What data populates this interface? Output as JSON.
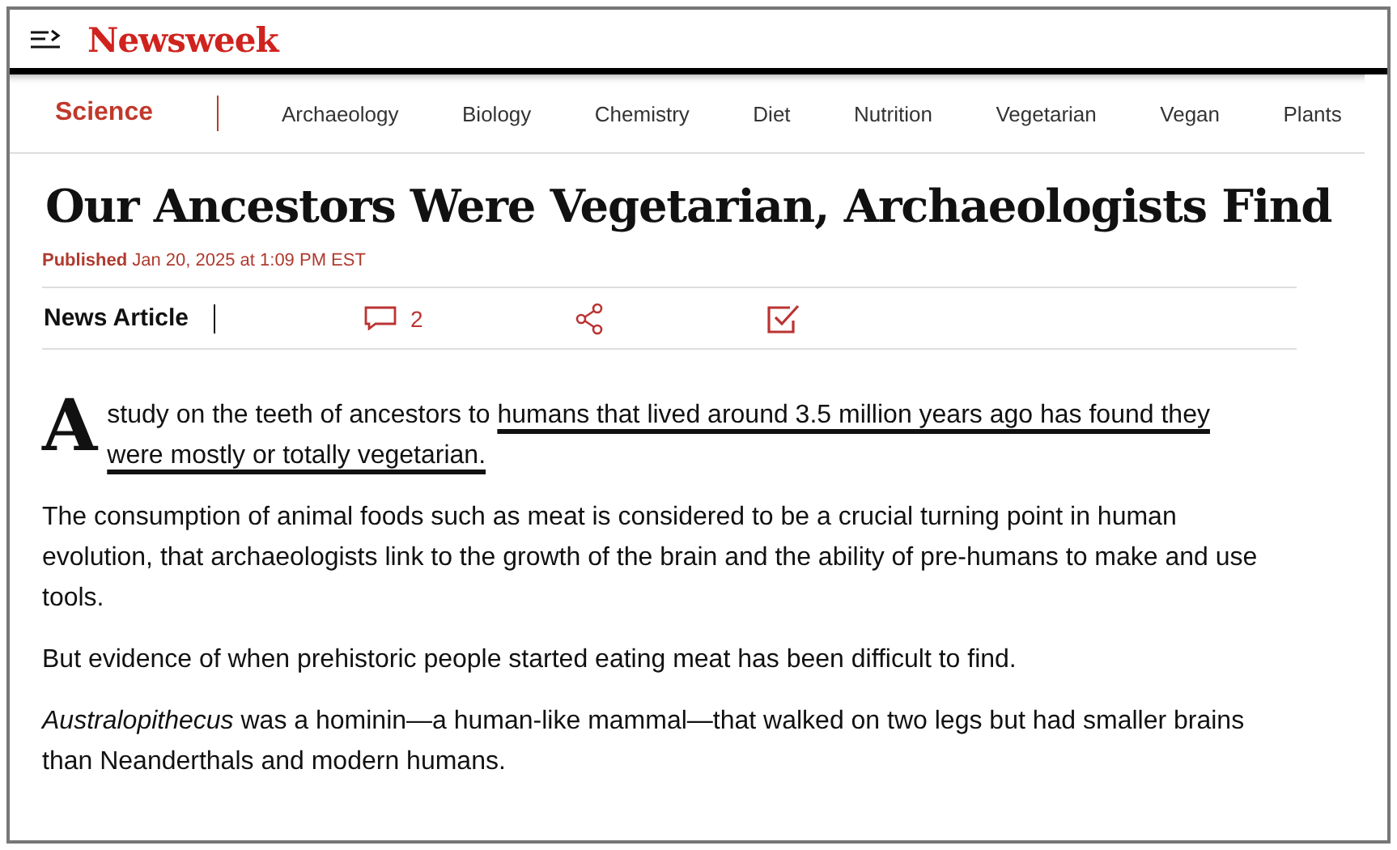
{
  "header": {
    "logo": "Newsweek"
  },
  "nav": {
    "items": [
      {
        "label": "Science",
        "selected": true
      },
      {
        "label": "Archaeology",
        "selected": false
      },
      {
        "label": "Biology",
        "selected": false
      },
      {
        "label": "Chemistry",
        "selected": false
      },
      {
        "label": "Diet",
        "selected": false
      },
      {
        "label": "Nutrition",
        "selected": false
      },
      {
        "label": "Vegetarian",
        "selected": false
      },
      {
        "label": "Vegan",
        "selected": false
      },
      {
        "label": "Plants",
        "selected": false
      }
    ]
  },
  "article": {
    "title": "Our Ancestors Were Vegetarian, Archaeologists Find",
    "published_label": "Published",
    "published_date": "Jan 20, 2025 at 1:09 PM EST",
    "type": "News Article",
    "comment_count": "2",
    "lead": {
      "drop_cap": "A",
      "segments": [
        {
          "text": "study on the teeth of ancestors to ",
          "underlined": false
        },
        {
          "text": "humans that lived around 3.5 million years ago has found they were mostly or totally vegetarian.",
          "underlined": true
        }
      ]
    },
    "paragraphs": [
      "The consumption of animal foods such as meat is considered to be a crucial turning point in human evolution, that archaeologists link to the growth of the brain and the ability of pre-humans to make and use tools.",
      "But evidence of when prehistoric people started eating meat has been difficult to find.",
      "*Australopithecus* was a hominin—a human-like mammal—that walked on two legs but had smaller brains than Neanderthals and modern humans."
    ]
  }
}
